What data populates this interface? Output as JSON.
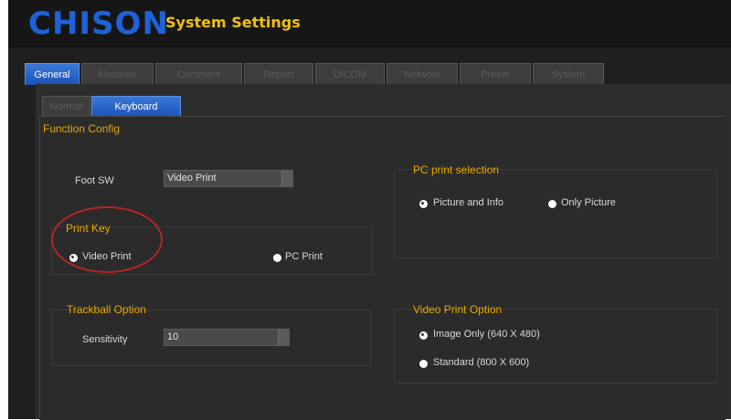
{
  "header": {
    "logo": "CHISON",
    "title": "System Settings"
  },
  "main_tabs": [
    {
      "label": "General",
      "active": true
    },
    {
      "label": "Measure",
      "active": false
    },
    {
      "label": "Comment",
      "active": false
    },
    {
      "label": "Report",
      "active": false
    },
    {
      "label": "DICOM",
      "active": false
    },
    {
      "label": "Network",
      "active": false
    },
    {
      "label": "Preset",
      "active": false
    },
    {
      "label": "System",
      "active": false
    }
  ],
  "sub_tabs": [
    {
      "label": "Normal",
      "active": false
    },
    {
      "label": "Keyboard",
      "active": true
    }
  ],
  "function_config": {
    "title": "Function Config"
  },
  "foot_sw": {
    "label": "Foot SW",
    "value": "Video Print"
  },
  "print_key": {
    "title": "Print Key",
    "options": [
      {
        "label": "Video Print",
        "checked": true
      },
      {
        "label": "PC Print",
        "checked": false
      }
    ]
  },
  "pc_print_selection": {
    "title": "PC print selection",
    "options": [
      {
        "label": "Picture and Info",
        "checked": true
      },
      {
        "label": "Only Picture",
        "checked": false
      }
    ]
  },
  "trackball_option": {
    "title": "Trackball Option",
    "sensitivity_label": "Sensitivity",
    "sensitivity_value": "10"
  },
  "video_print_option": {
    "title": "Video Print Option",
    "options": [
      {
        "label": "Image Only (640 X 480)",
        "checked": true
      },
      {
        "label": "Standard (800 X 600)",
        "checked": false
      }
    ]
  },
  "colors": {
    "accent_yellow": "#e6a800",
    "tab_blue": "#2b66c8",
    "logo_blue": "#1e62d8",
    "title_yellow": "#f2c200",
    "annotation_red": "#b52626"
  }
}
